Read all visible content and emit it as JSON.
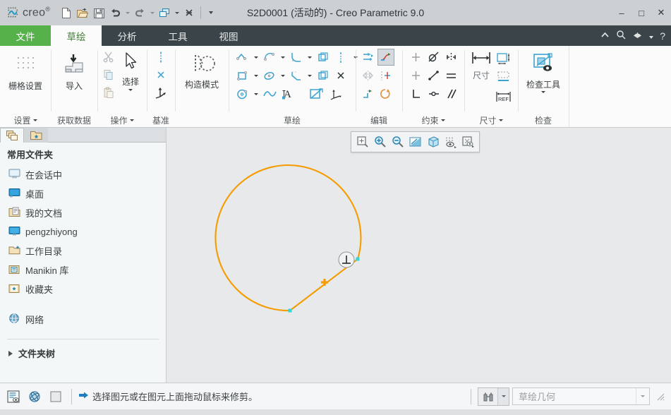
{
  "window": {
    "title": "S2D0001 (活动的) - Creo Parametric 9.0",
    "brand": "creo",
    "brand_sup": "®",
    "minimize": "–",
    "maximize": "□",
    "close": "✕"
  },
  "quick_access": [
    {
      "name": "new-file-icon",
      "label": "新建"
    },
    {
      "name": "open-file-icon",
      "label": "打开"
    },
    {
      "name": "save-icon",
      "label": "保存"
    },
    {
      "name": "undo-icon",
      "label": "撤消"
    },
    {
      "name": "redo-icon",
      "label": "重做"
    },
    {
      "name": "regenerate-icon",
      "label": "重新生成"
    },
    {
      "name": "close-window-icon",
      "label": "关闭"
    },
    {
      "name": "customize-qat-icon",
      "label": "自定义快速访问工具栏"
    }
  ],
  "tabs": [
    {
      "label": "文件",
      "kind": "file"
    },
    {
      "label": "草绘",
      "kind": "active"
    },
    {
      "label": "分析",
      "kind": "normal"
    },
    {
      "label": "工具",
      "kind": "normal"
    },
    {
      "label": "视图",
      "kind": "normal"
    }
  ],
  "tab_right_icons": [
    {
      "name": "collapse-ribbon-icon",
      "glyph": "⌃"
    },
    {
      "name": "search-icon",
      "glyph": "⌕"
    },
    {
      "name": "help-menu-icon",
      "glyph": "◓"
    },
    {
      "name": "help-dropdown-icon",
      "glyph": "▾"
    },
    {
      "name": "help-icon",
      "glyph": "?"
    }
  ],
  "ribbon": {
    "groups": [
      {
        "title": "设置",
        "has_dropdown": true,
        "buttons": [
          {
            "name": "grid-settings-button",
            "label": "栅格设置",
            "icon": "grid-icon"
          }
        ]
      },
      {
        "title": "获取数据",
        "has_dropdown": false,
        "buttons": [
          {
            "name": "import-button",
            "label": "导入",
            "icon": "import-icon"
          }
        ]
      },
      {
        "title": "操作",
        "has_dropdown": true,
        "buttons": [
          {
            "name": "cut-button",
            "label": "剪切",
            "icon": "scissors-icon"
          },
          {
            "name": "copy-button",
            "label": "复制",
            "icon": "copy-icon"
          },
          {
            "name": "paste-button",
            "label": "粘贴",
            "icon": "paste-icon"
          },
          {
            "name": "select-button",
            "label": "选择",
            "icon": "cursor-icon"
          }
        ]
      },
      {
        "title": "基准",
        "has_dropdown": false,
        "buttons": [
          {
            "name": "centerline-button",
            "label": "中心线",
            "icon": "centerline-icon"
          },
          {
            "name": "point-button",
            "label": "点",
            "icon": "point-icon"
          },
          {
            "name": "coord-system-button",
            "label": "坐标系",
            "icon": "coordinate-system-icon"
          }
        ]
      },
      {
        "title": "",
        "has_dropdown": false,
        "buttons": [
          {
            "name": "construction-mode-button",
            "label": "构造模式",
            "icon": "construction-mode-icon"
          }
        ]
      },
      {
        "title": "草绘",
        "has_dropdown": false,
        "buttons": [
          {
            "name": "line-chain-button",
            "label": "线链",
            "icon": "line-icon"
          },
          {
            "name": "arc-button",
            "label": "圆弧",
            "icon": "arc-icon"
          },
          {
            "name": "fillet-button",
            "label": "圆角",
            "icon": "fillet-icon"
          },
          {
            "name": "offset-button",
            "label": "偏移",
            "icon": "offset-icon"
          },
          {
            "name": "construction-centerline-button",
            "label": "中心线",
            "icon": "dashed-line-icon"
          },
          {
            "name": "rectangle-button",
            "label": "矩形",
            "icon": "rectangle-icon"
          },
          {
            "name": "ellipse-button",
            "label": "椭圆",
            "icon": "ellipse-icon"
          },
          {
            "name": "chamfer-button",
            "label": "倒角",
            "icon": "chamfer-icon"
          },
          {
            "name": "thicken-button",
            "label": "加厚",
            "icon": "thicken-icon"
          },
          {
            "name": "construction-point-button",
            "label": "点",
            "icon": "construction-point-icon"
          },
          {
            "name": "circle-button",
            "label": "圆",
            "icon": "circle-icon"
          },
          {
            "name": "spline-button",
            "label": "样条",
            "icon": "spline-icon"
          },
          {
            "name": "text-button",
            "label": "文本",
            "icon": "text-icon"
          },
          {
            "name": "project-button",
            "label": "投影",
            "icon": "project-icon"
          },
          {
            "name": "coordinate-button",
            "label": "坐标系",
            "icon": "coord-icon"
          }
        ]
      },
      {
        "title": "编辑",
        "has_dropdown": false,
        "buttons": [
          {
            "name": "modify-button",
            "label": "修改",
            "icon": "modify-icon"
          },
          {
            "name": "trim-button",
            "label": "删除段",
            "icon": "trim-icon",
            "selected": true
          },
          {
            "name": "mirror-button",
            "label": "镜像",
            "icon": "mirror-icon"
          },
          {
            "name": "divide-button",
            "label": "分割",
            "icon": "divide-icon"
          },
          {
            "name": "corner-button",
            "label": "拐角",
            "icon": "corner-icon"
          },
          {
            "name": "rotate-resize-button",
            "label": "旋转调整大小",
            "icon": "rotate-resize-icon"
          }
        ]
      },
      {
        "title": "约束",
        "has_dropdown": true,
        "buttons": [
          {
            "name": "vertical-constraint-button",
            "label": "竖直",
            "icon": "vertical-icon"
          },
          {
            "name": "tangent-constraint-button",
            "label": "相切",
            "icon": "tangent-icon"
          },
          {
            "name": "symmetric-constraint-button",
            "label": "对称",
            "icon": "symmetric-icon"
          },
          {
            "name": "horizontal-constraint-button",
            "label": "水平",
            "icon": "horizontal-icon"
          },
          {
            "name": "midpoint-constraint-button",
            "label": "中点",
            "icon": "midpoint-icon"
          },
          {
            "name": "equal-constraint-button",
            "label": "相等",
            "icon": "equal-icon"
          },
          {
            "name": "perpendicular-constraint-button",
            "label": "垂直",
            "icon": "perpendicular-icon"
          },
          {
            "name": "coincident-constraint-button",
            "label": "重合",
            "icon": "coincident-icon"
          },
          {
            "name": "parallel-constraint-button",
            "label": "平行",
            "icon": "parallel-icon"
          }
        ]
      },
      {
        "title": "尺寸",
        "has_dropdown": true,
        "buttons": [
          {
            "name": "dimension-button",
            "label": "尺寸",
            "icon": "dimension-icon"
          },
          {
            "name": "perimeter-dimension-button",
            "label": "周长",
            "icon": "perimeter-icon"
          },
          {
            "name": "baseline-button",
            "label": "基线",
            "icon": "baseline-icon"
          },
          {
            "name": "reference-dimension-button",
            "label": "参考尺寸",
            "icon": "ref-dimension-icon"
          }
        ]
      },
      {
        "title": "检查",
        "has_dropdown": false,
        "buttons": [
          {
            "name": "inspect-tool-button",
            "label": "检查工具",
            "icon": "inspect-icon"
          }
        ]
      }
    ]
  },
  "navigator": {
    "tabs": [
      {
        "name": "model-tree-tab",
        "icon": "layers-icon",
        "active": true
      },
      {
        "name": "folder-browser-tab",
        "icon": "favorites-folder-icon",
        "active": false
      }
    ],
    "heading": "常用文件夹",
    "items": [
      {
        "label": "在会话中",
        "icon": "in-session-icon"
      },
      {
        "label": "桌面",
        "icon": "desktop-icon"
      },
      {
        "label": "我的文档",
        "icon": "my-documents-icon"
      },
      {
        "label": "pengzhiyong",
        "icon": "user-folder-icon"
      },
      {
        "label": "工作目录",
        "icon": "working-directory-icon"
      },
      {
        "label": "Manikin 库",
        "icon": "manikin-library-icon"
      },
      {
        "label": "收藏夹",
        "icon": "favorites-icon"
      }
    ],
    "network_item": {
      "label": "网络",
      "icon": "network-icon"
    },
    "folder_tree": {
      "label": "文件夹树",
      "icon": "expand-triangle-icon"
    }
  },
  "viewbar": {
    "buttons": [
      {
        "name": "refit-icon",
        "label": "重新调整"
      },
      {
        "name": "zoom-in-icon",
        "label": "放大"
      },
      {
        "name": "zoom-out-icon",
        "label": "缩小"
      },
      {
        "name": "display-style-icon",
        "label": "显示样式"
      },
      {
        "name": "orientation-icon",
        "label": "已保存方向"
      },
      {
        "name": "datum-display-icon",
        "label": "基准显示过滤器"
      },
      {
        "name": "annotation-display-icon",
        "label": "注释显示"
      }
    ]
  },
  "sketch": {
    "entity_color": "#f59c00",
    "vertex_color": "#2ad8e0",
    "constraint_badge": "perpendicular-constraint-symbol",
    "constraint_glyph": "⊥",
    "midpoint_marker": "midpoint-cross-marker"
  },
  "statusbar": {
    "left_buttons": [
      {
        "name": "model-display-toggle",
        "label": "模型显示"
      },
      {
        "name": "spin-center-toggle",
        "label": "旋转中心"
      },
      {
        "name": "plane-display-toggle",
        "label": "平面显示"
      }
    ],
    "message_icon": "arrow-right-icon",
    "message": "选择图元或在图元上面拖动鼠标来修剪。",
    "search_icon": "binoculars-icon",
    "search_dropdown_icon": "chevron-down-icon",
    "filter_value": "草绘几何",
    "filter_dropdown_icon": "chevron-down-icon",
    "resize_grip": "resize-grip-icon"
  }
}
